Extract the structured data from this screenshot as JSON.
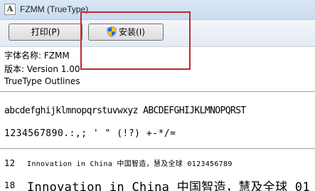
{
  "window": {
    "title": "FZMM (TrueType)",
    "icon": "font-file-icon",
    "icon_glyph": "A"
  },
  "toolbar": {
    "print_label": "打印(P)",
    "install_label": "安装(I)"
  },
  "font_info": {
    "name_line": "字体名称: FZMM",
    "version_line": "版本: Version 1.00",
    "type_line": "TrueType Outlines"
  },
  "samples": {
    "alphabet": "abcdefghijklmnopqrstuvwxyz ABCDEFGHIJKLMNOPQRST",
    "digits_symbols": "1234567890.:,; ' \" (!?) +-*/="
  },
  "previews": [
    {
      "size": "12",
      "text": "Innovation in China 中国智造，慧及全球 0123456789"
    },
    {
      "size": "18",
      "text": "Innovation in China 中国智造，慧及全球 01"
    }
  ],
  "colors": {
    "highlight_box": "#c0282f",
    "titlebar": "#dbe7f4",
    "shield_blue": "#2b63c6",
    "shield_yellow": "#f2c21b"
  }
}
